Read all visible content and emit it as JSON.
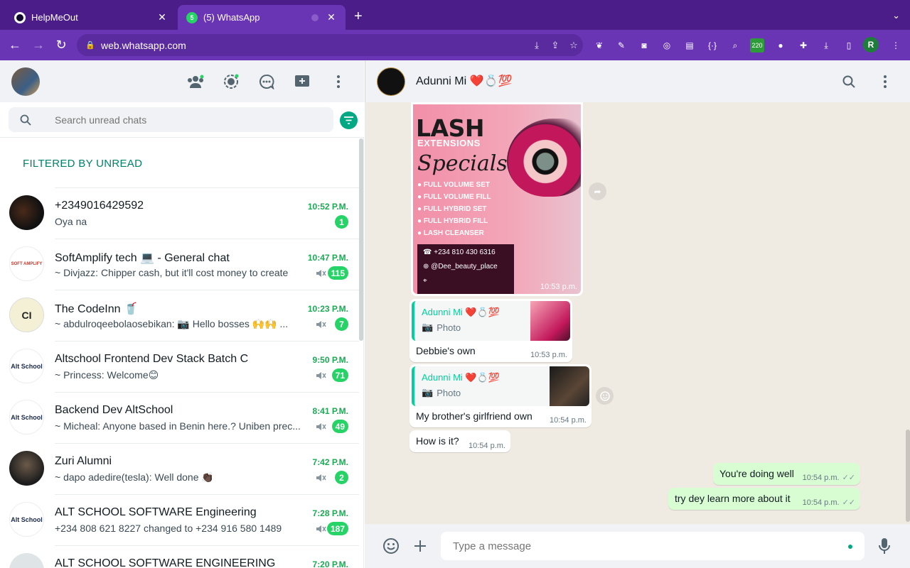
{
  "browser": {
    "tabs": [
      {
        "title": "HelpMeOut",
        "active": false
      },
      {
        "title": "(5) WhatsApp",
        "active": true
      }
    ],
    "url": "web.whatsapp.com",
    "profile_initial": "R",
    "ext_badge": "220"
  },
  "left": {
    "search_placeholder": "Search unread chats",
    "filter_label": "FILTERED BY UNREAD",
    "chats": [
      {
        "name": "+2349016429592",
        "time": "10:52 P.M.",
        "preview": "Oya na",
        "badge": "1",
        "muted": false
      },
      {
        "name": "SoftAmplify tech 💻 - General chat",
        "time": "10:47 P.M.",
        "preview": "~ Divjazz: Chipper cash, but it'll cost money to create",
        "badge": "115",
        "muted": true
      },
      {
        "name": "The CodeInn 🥤",
        "time": "10:23 P.M.",
        "preview": "~ abdulroqeebolaosebikan: 📷 Hello bosses 🙌🙌 ...",
        "badge": "7",
        "muted": true
      },
      {
        "name": "Altschool Frontend Dev Stack Batch C",
        "time": "9:50 P.M.",
        "preview": "~ Princess: Welcome😊",
        "badge": "71",
        "muted": true
      },
      {
        "name": "Backend Dev AltSchool",
        "time": "8:41 P.M.",
        "preview": "~ Micheal: Anyone based in Benin here.? Uniben prec...",
        "badge": "49",
        "muted": true
      },
      {
        "name": "Zuri Alumni",
        "time": "7:42 P.M.",
        "preview": "~ dapo adedire(tesla): Well done 👏🏿",
        "badge": "2",
        "muted": true
      },
      {
        "name": "ALT SCHOOL SOFTWARE Engineering",
        "time": "7:28 P.M.",
        "preview": "+234 808 621 8227 changed to +234 916 580 1489",
        "badge": "187",
        "muted": true
      },
      {
        "name": "ALT SCHOOL SOFTWARE ENGINEERING",
        "time": "7:20 P.M.",
        "preview": "",
        "badge": "",
        "muted": false
      }
    ],
    "avatar_labels": [
      "",
      "SOFT AMPLIFY",
      "CI",
      "Alt School",
      "Alt School",
      "",
      "Alt School",
      ""
    ]
  },
  "chat": {
    "title": "Adunni Mi ❤️💍💯",
    "poster": {
      "heading1": "LASH",
      "heading2": "EXTENSIONS",
      "heading3": "Specials",
      "items": [
        "FULL VOLUME SET",
        "FULL VOLUME FILL",
        "FULL HYBRID SET",
        "FULL HYBRID FILL",
        "LASH CLEANSER"
      ],
      "phone": "+234 810 430 6316",
      "handle": "@Dee_beauty_place",
      "time": "10:53 p.m."
    },
    "messages": [
      {
        "quote_name": "Adunni Mi ❤️💍💯",
        "quote_type": "Photo",
        "text": "Debbie's own",
        "time": "10:53 p.m."
      },
      {
        "quote_name": "Adunni Mi ❤️💍💯",
        "quote_type": "Photo",
        "text": "My brother's girlfriend own",
        "time": "10:54 p.m."
      },
      {
        "text": "How is it?",
        "time": "10:54 p.m."
      },
      {
        "text": "You're doing well",
        "time": "10:54 p.m."
      },
      {
        "text": "try dey learn more about it",
        "time": "10:54 p.m."
      }
    ],
    "composer_placeholder": "Type a message"
  },
  "colors": {
    "accent": "#00a884",
    "unread_green": "#25d366",
    "chrome": "#6a35b5"
  }
}
